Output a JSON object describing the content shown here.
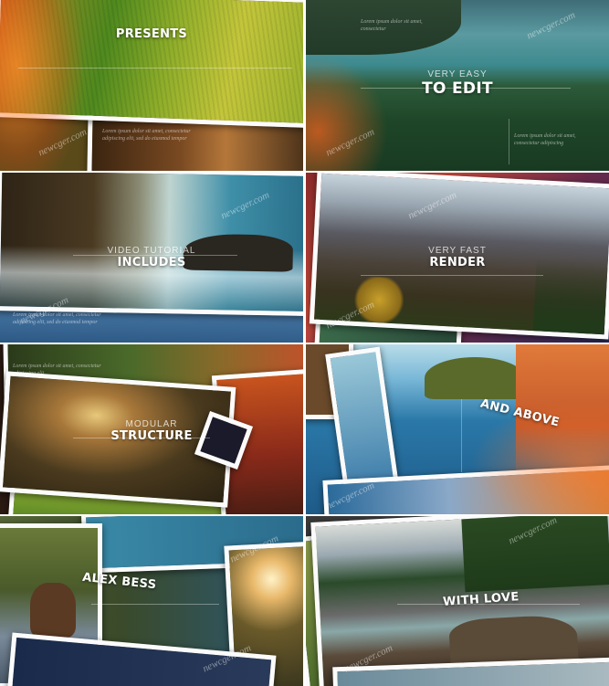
{
  "watermark": "newcger.com",
  "ghost_text": "Lorem ipsum dolor sit amet, consectetur adipiscing elit, sed do eiusmod tempor",
  "panels": [
    {
      "id": "presents",
      "small": "",
      "big": "PRESENTS"
    },
    {
      "id": "to-edit",
      "small": "VERY EASY",
      "big": "TO EDIT"
    },
    {
      "id": "includes",
      "small": "VIDEO TUTORIAL",
      "big": "INCLUDES"
    },
    {
      "id": "render",
      "small": "VERY FAST",
      "big": "RENDER"
    },
    {
      "id": "structure",
      "small": "MODULAR",
      "big": "STRUCTURE"
    },
    {
      "id": "and-above",
      "small": "",
      "big": "AND ABOVE"
    },
    {
      "id": "alex-bess",
      "small": "",
      "big": "ALEX BESS"
    },
    {
      "id": "with-love",
      "small": "",
      "big": "WITH LOVE"
    }
  ]
}
